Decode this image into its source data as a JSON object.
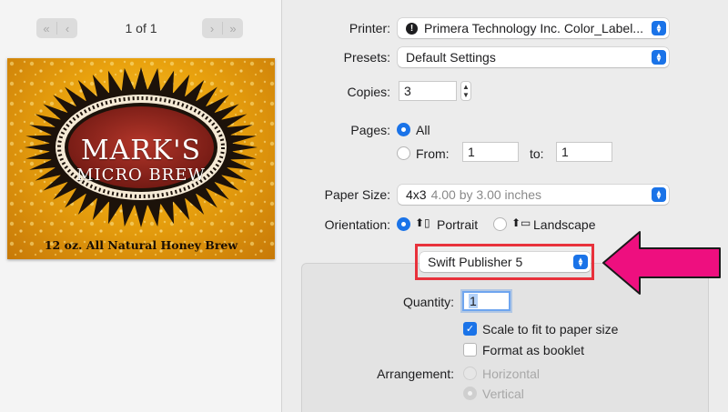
{
  "preview": {
    "page_indicator": "1 of 1",
    "label": {
      "title_line_1": "MARK'S",
      "title_line_2": "MICRO BREW",
      "footer": "12 oz. All Natural Honey Brew"
    }
  },
  "settings": {
    "printer": {
      "label": "Printer:",
      "value": "Primera Technology Inc. Color_Label..."
    },
    "presets": {
      "label": "Presets:",
      "value": "Default Settings"
    },
    "copies": {
      "label": "Copies:",
      "value": "3"
    },
    "pages": {
      "label": "Pages:",
      "all_label": "All",
      "from_label": "From:",
      "from_value": "1",
      "to_label": "to:",
      "to_value": "1",
      "selected": "All"
    },
    "paper_size": {
      "label": "Paper Size:",
      "value": "4x3",
      "detail": "4.00 by 3.00 inches"
    },
    "orientation": {
      "label": "Orientation:",
      "portrait_label": "Portrait",
      "landscape_label": "Landscape",
      "selected": "Portrait"
    },
    "app_section": {
      "value": "Swift Publisher 5"
    },
    "quantity": {
      "label": "Quantity:",
      "value": "1"
    },
    "scale_to_fit": {
      "label": "Scale to fit to paper size",
      "checked": true
    },
    "format_booklet": {
      "label": "Format as booklet",
      "checked": false
    },
    "arrangement": {
      "label": "Arrangement:",
      "horizontal_label": "Horizontal",
      "vertical_label": "Vertical",
      "selected": "Vertical"
    }
  },
  "colors": {
    "accent": "#1a73e8",
    "highlight_box": "#e8313b",
    "arrow": "#ee0f7f"
  }
}
